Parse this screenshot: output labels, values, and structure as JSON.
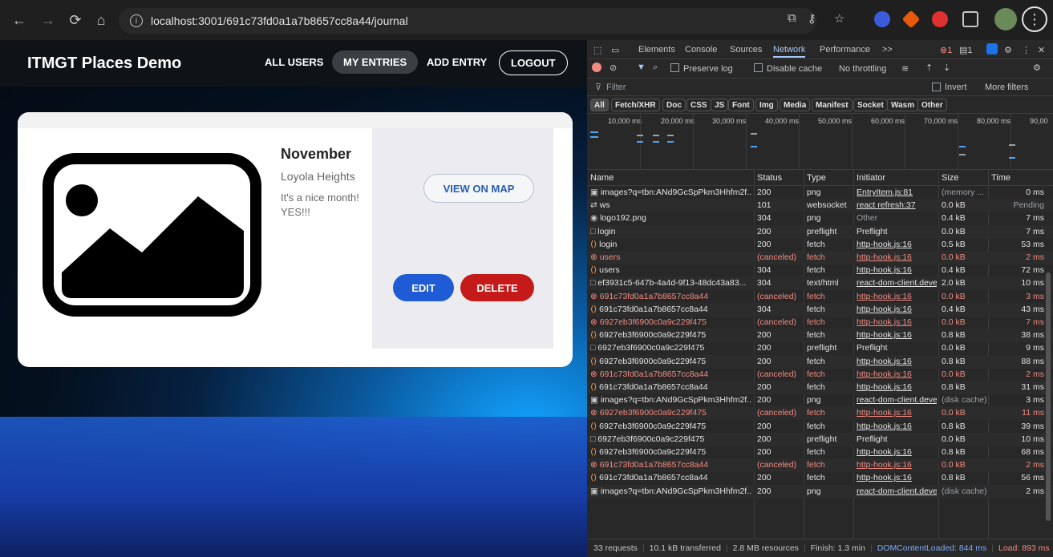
{
  "browser": {
    "url": "localhost:3001/691c73fd0a1a7b8657cc8a44/journal",
    "icons": [
      "back-icon",
      "forward-icon",
      "reload-icon",
      "home-icon",
      "info-icon",
      "cast-icon",
      "key-icon",
      "star-icon",
      "extensions-icon",
      "menu-icon"
    ]
  },
  "app": {
    "title": "ITMGT Places Demo",
    "nav": {
      "all_users": "ALL USERS",
      "my_entries": "MY ENTRIES",
      "add_entry": "ADD ENTRY",
      "logout": "LOGOUT"
    },
    "entry": {
      "title": "November",
      "place": "Loyola Heights",
      "description": "It's a nice month! YES!!!",
      "view_on_map": "VIEW ON MAP",
      "edit": "EDIT",
      "delete": "DELETE"
    }
  },
  "devtools": {
    "tabs": [
      "Elements",
      "Console",
      "Sources",
      "Network",
      "Performance",
      ">>"
    ],
    "active_tab": "Network",
    "badges": {
      "errors": "1",
      "warnings": "1"
    },
    "toolbar": {
      "preserve_log": "Preserve log",
      "disable_cache": "Disable cache",
      "throttling": "No throttling"
    },
    "filter": {
      "placeholder": "Filter",
      "invert": "Invert",
      "more_filters": "More filters"
    },
    "types": [
      "All",
      "Fetch/XHR",
      "Doc",
      "CSS",
      "JS",
      "Font",
      "Img",
      "Media",
      "Manifest",
      "Socket",
      "Wasm",
      "Other"
    ],
    "timeline_ticks": [
      "10,000 ms",
      "20,000 ms",
      "30,000 ms",
      "40,000 ms",
      "50,000 ms",
      "60,000 ms",
      "70,000 ms",
      "80,000 ms",
      "90,00"
    ],
    "columns": [
      "Name",
      "Status",
      "Type",
      "Initiator",
      "Size",
      "Time"
    ],
    "rows": [
      {
        "icon": "img",
        "name": "images?q=tbn:ANd9GcSpPkm3Hhfm2f...",
        "status": "200",
        "type": "png",
        "initiator": "EntryItem.js:81",
        "size": "(memory ...",
        "time": "0 ms",
        "err": false
      },
      {
        "icon": "ws",
        "name": "ws",
        "status": "101",
        "type": "websocket",
        "initiator": "react refresh:37",
        "size": "0.0 kB",
        "time": "Pending",
        "err": false
      },
      {
        "icon": "png",
        "name": "logo192.png",
        "status": "304",
        "type": "png",
        "initiator": "Other",
        "size": "0.4 kB",
        "time": "7 ms",
        "err": false
      },
      {
        "icon": "doc",
        "name": "login",
        "status": "200",
        "type": "preflight",
        "initiator": "Preflight",
        "size": "0.0 kB",
        "time": "7 ms",
        "err": false
      },
      {
        "icon": "xhr",
        "name": "login",
        "status": "200",
        "type": "fetch",
        "initiator": "http-hook.js:16",
        "size": "0.5 kB",
        "time": "53 ms",
        "err": false
      },
      {
        "icon": "err",
        "name": "users",
        "status": "(canceled)",
        "type": "fetch",
        "initiator": "http-hook.js:16",
        "size": "0.0 kB",
        "time": "2 ms",
        "err": true
      },
      {
        "icon": "xhr",
        "name": "users",
        "status": "304",
        "type": "fetch",
        "initiator": "http-hook.js:16",
        "size": "0.4 kB",
        "time": "72 ms",
        "err": false
      },
      {
        "icon": "doc",
        "name": "ef3931c5-647b-4a4d-9f13-48dc43a83...",
        "status": "304",
        "type": "text/html",
        "initiator": "react-dom-client.deve",
        "size": "2.0 kB",
        "time": "10 ms",
        "err": false
      },
      {
        "icon": "err",
        "name": "691c73fd0a1a7b8657cc8a44",
        "status": "(canceled)",
        "type": "fetch",
        "initiator": "http-hook.js:16",
        "size": "0.0 kB",
        "time": "3 ms",
        "err": true
      },
      {
        "icon": "xhr",
        "name": "691c73fd0a1a7b8657cc8a44",
        "status": "304",
        "type": "fetch",
        "initiator": "http-hook.js:16",
        "size": "0.4 kB",
        "time": "43 ms",
        "err": false
      },
      {
        "icon": "err",
        "name": "6927eb3f6900c0a9c229f475",
        "status": "(canceled)",
        "type": "fetch",
        "initiator": "http-hook.js:16",
        "size": "0.0 kB",
        "time": "7 ms",
        "err": true
      },
      {
        "icon": "xhr",
        "name": "6927eb3f6900c0a9c229f475",
        "status": "200",
        "type": "fetch",
        "initiator": "http-hook.js:16",
        "size": "0.8 kB",
        "time": "38 ms",
        "err": false
      },
      {
        "icon": "doc",
        "name": "6927eb3f6900c0a9c229f475",
        "status": "200",
        "type": "preflight",
        "initiator": "Preflight",
        "size": "0.0 kB",
        "time": "9 ms",
        "err": false
      },
      {
        "icon": "xhr",
        "name": "6927eb3f6900c0a9c229f475",
        "status": "200",
        "type": "fetch",
        "initiator": "http-hook.js:16",
        "size": "0.8 kB",
        "time": "88 ms",
        "err": false
      },
      {
        "icon": "err",
        "name": "691c73fd0a1a7b8657cc8a44",
        "status": "(canceled)",
        "type": "fetch",
        "initiator": "http-hook.js:16",
        "size": "0.0 kB",
        "time": "2 ms",
        "err": true
      },
      {
        "icon": "xhr",
        "name": "691c73fd0a1a7b8657cc8a44",
        "status": "200",
        "type": "fetch",
        "initiator": "http-hook.js:16",
        "size": "0.8 kB",
        "time": "31 ms",
        "err": false
      },
      {
        "icon": "img",
        "name": "images?q=tbn:ANd9GcSpPkm3Hhfm2f...",
        "status": "200",
        "type": "png",
        "initiator": "react-dom-client.deve",
        "size": "(disk cache)",
        "time": "3 ms",
        "err": false
      },
      {
        "icon": "err",
        "name": "6927eb3f6900c0a9c229f475",
        "status": "(canceled)",
        "type": "fetch",
        "initiator": "http-hook.js:16",
        "size": "0.0 kB",
        "time": "11 ms",
        "err": true
      },
      {
        "icon": "xhr",
        "name": "6927eb3f6900c0a9c229f475",
        "status": "200",
        "type": "fetch",
        "initiator": "http-hook.js:16",
        "size": "0.8 kB",
        "time": "39 ms",
        "err": false
      },
      {
        "icon": "doc",
        "name": "6927eb3f6900c0a9c229f475",
        "status": "200",
        "type": "preflight",
        "initiator": "Preflight",
        "size": "0.0 kB",
        "time": "10 ms",
        "err": false
      },
      {
        "icon": "xhr",
        "name": "6927eb3f6900c0a9c229f475",
        "status": "200",
        "type": "fetch",
        "initiator": "http-hook.js:16",
        "size": "0.8 kB",
        "time": "68 ms",
        "err": false
      },
      {
        "icon": "err",
        "name": "691c73fd0a1a7b8657cc8a44",
        "status": "(canceled)",
        "type": "fetch",
        "initiator": "http-hook.js:16",
        "size": "0.0 kB",
        "time": "2 ms",
        "err": true
      },
      {
        "icon": "xhr",
        "name": "691c73fd0a1a7b8657cc8a44",
        "status": "200",
        "type": "fetch",
        "initiator": "http-hook.js:16",
        "size": "0.8 kB",
        "time": "56 ms",
        "err": false
      },
      {
        "icon": "img",
        "name": "images?q=tbn:ANd9GcSpPkm3Hhfm2f...",
        "status": "200",
        "type": "png",
        "initiator": "react-dom-client.deve",
        "size": "(disk cache)",
        "time": "2 ms",
        "err": false
      }
    ],
    "status_bar": {
      "requests": "33 requests",
      "transferred": "10.1 kB transferred",
      "resources": "2.8 MB resources",
      "finish": "Finish: 1.3 min",
      "dom_content_loaded": "DOMContentLoaded: 844 ms",
      "load": "Load: 893 ms"
    }
  }
}
